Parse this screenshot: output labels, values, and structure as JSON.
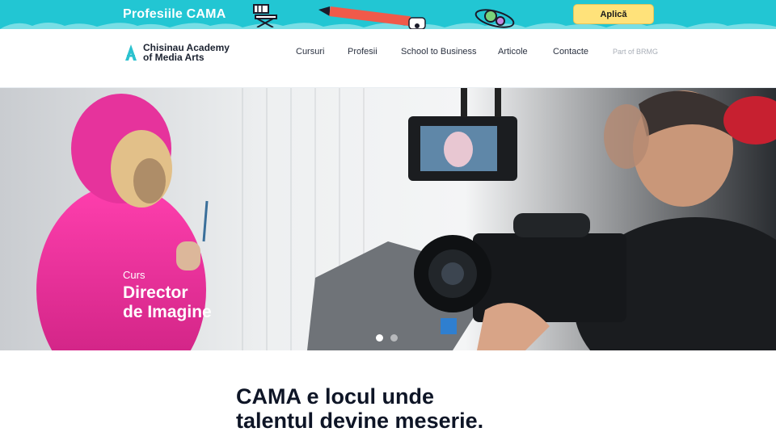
{
  "promo": {
    "title": "Profesiile CAMA",
    "apply_label": "Aplică",
    "colors": {
      "background": "#22c6d3",
      "button": "#ffe27a"
    }
  },
  "header": {
    "logo": {
      "line1": "Chisinau Academy",
      "line2": "of Media Arts",
      "icon": "cama-logo-icon"
    },
    "nav": [
      "Cursuri",
      "Profesii",
      "School to Business",
      "Articole",
      "Contacte"
    ],
    "part_of": "Part of BRMG"
  },
  "hero": {
    "kicker": "Curs",
    "title_line1": "Director",
    "title_line2": "de Imagine",
    "slides": {
      "count": 2,
      "active": 1
    }
  },
  "tagline": {
    "line1": "CAMA e locul unde",
    "line2": "talentul devine meserie."
  }
}
